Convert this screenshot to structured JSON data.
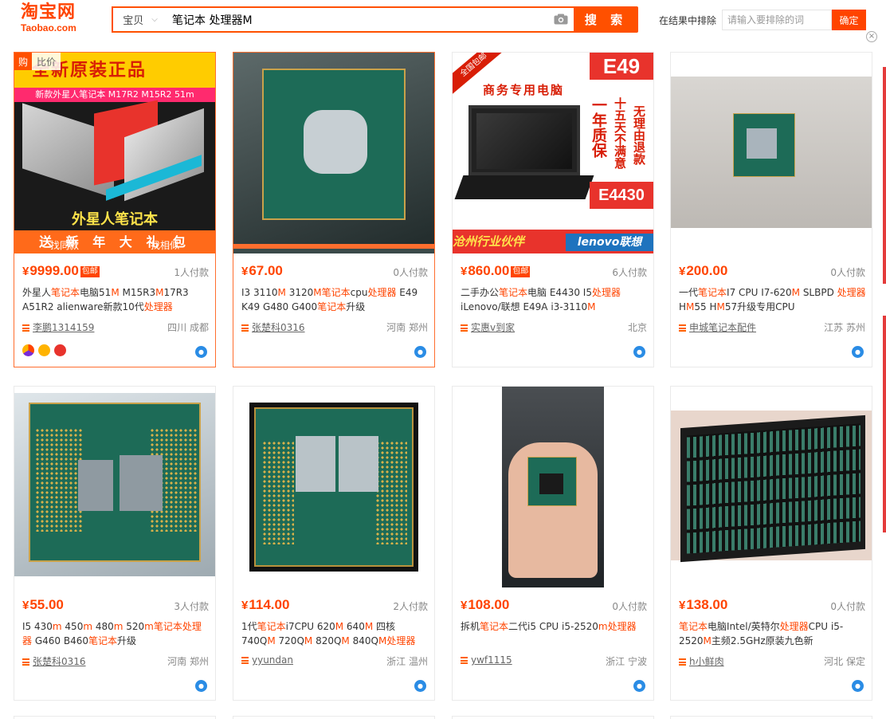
{
  "header": {
    "logo_cn": "淘宝网",
    "logo_en": "Taobao.com",
    "search_category": "宝贝",
    "search_query": "笔记本 处理器M",
    "search_button": "搜 索",
    "exclude_label": "在结果中排除",
    "exclude_placeholder": "请输入要排除的词",
    "confirm_button": "确定",
    "close_symbol": "×"
  },
  "colors": {
    "accent": "#ff4400",
    "search_border": "#ff5000",
    "link": "#666666",
    "wangwang": "#2a8ce5"
  },
  "card_overlay": {
    "buy_tag": "购",
    "compare_tag": "比价",
    "find_same": "找同款",
    "find_similar": "找相似"
  },
  "product_images": {
    "p1": {
      "headline": "全新原装正品",
      "subhead": "新款外星人笔记本 M17R2 M15R2 51m",
      "caption": "外星人笔记本",
      "footer": "送 新 年 大 礼 包"
    },
    "p3": {
      "corner": "全国包邮",
      "model_top": "E49",
      "headline": "商务专用电脑",
      "tagline1": "一年质保",
      "tagline2": "十五天不满意",
      "tagline3": "无理由退款",
      "model_bottom": "E4430",
      "footer": "沧州行业伙伴",
      "brand": "lenovo联想"
    }
  },
  "products": [
    {
      "price": "9999.00",
      "baoyou": "包邮",
      "paid": "1人付款",
      "title": [
        [
          "外星人",
          false
        ],
        [
          "笔记本",
          true
        ],
        [
          "电脑51",
          false
        ],
        [
          "M",
          true
        ],
        [
          " M15R3",
          false
        ],
        [
          "M",
          true
        ],
        [
          "17R3 A51R2 alienware新款10代",
          false
        ],
        [
          "处理器",
          true
        ]
      ],
      "shop": "李鹏1314159",
      "location": "四川 成都"
    },
    {
      "price": "67.00",
      "baoyou": "",
      "paid": "0人付款",
      "title": [
        [
          "I3 3110",
          false
        ],
        [
          "M",
          true
        ],
        [
          " 3120",
          false
        ],
        [
          "M",
          true
        ],
        [
          "笔记本",
          true
        ],
        [
          "cpu",
          false
        ],
        [
          "处理器",
          true
        ],
        [
          " E49 K49 G480 G400",
          false
        ],
        [
          "笔记本",
          true
        ],
        [
          "升级",
          false
        ]
      ],
      "shop": "张楚科0316",
      "location": "河南 郑州"
    },
    {
      "price": "860.00",
      "baoyou": "包邮",
      "paid": "6人付款",
      "title": [
        [
          "二手办公",
          false
        ],
        [
          "笔记本",
          true
        ],
        [
          "电脑 E4430 I5",
          false
        ],
        [
          "处理器",
          true
        ],
        [
          " iLenovo/联想 E49A i3-3110",
          false
        ],
        [
          "M",
          true
        ]
      ],
      "shop": "实惠v到家",
      "location": "北京"
    },
    {
      "price": "200.00",
      "baoyou": "",
      "paid": "0人付款",
      "title": [
        [
          "一代",
          false
        ],
        [
          "笔记本",
          true
        ],
        [
          "I7 CPU I7-620",
          false
        ],
        [
          "M",
          true
        ],
        [
          " SLBPD ",
          false
        ],
        [
          "处理器",
          true
        ],
        [
          " H",
          false
        ],
        [
          "M",
          true
        ],
        [
          "55 H",
          false
        ],
        [
          "M",
          true
        ],
        [
          "57升级专用CPU",
          false
        ]
      ],
      "shop": "申城笔记本配件",
      "location": "江苏 苏州"
    },
    {
      "price": "55.00",
      "baoyou": "",
      "paid": "3人付款",
      "title": [
        [
          "I5 430",
          false
        ],
        [
          "m",
          true
        ],
        [
          " 450",
          false
        ],
        [
          "m",
          true
        ],
        [
          " 480",
          false
        ],
        [
          "m",
          true
        ],
        [
          " 520",
          false
        ],
        [
          "m",
          true
        ],
        [
          "笔记本",
          true
        ],
        [
          "处理器",
          true
        ],
        [
          " G460 B460",
          false
        ],
        [
          "笔记本",
          true
        ],
        [
          "升级",
          false
        ]
      ],
      "shop": "张楚科0316",
      "location": "河南 郑州"
    },
    {
      "price": "114.00",
      "baoyou": "",
      "paid": "2人付款",
      "title": [
        [
          "1代",
          false
        ],
        [
          "笔记本",
          true
        ],
        [
          "i7CPU 620",
          false
        ],
        [
          "M",
          true
        ],
        [
          " 640",
          false
        ],
        [
          "M",
          true
        ],
        [
          " 四核 740Q",
          false
        ],
        [
          "M",
          true
        ],
        [
          " 720Q",
          false
        ],
        [
          "M",
          true
        ],
        [
          " 820Q",
          false
        ],
        [
          "M",
          true
        ],
        [
          " 840Q",
          false
        ],
        [
          "M",
          true
        ],
        [
          "处理器",
          true
        ]
      ],
      "shop": "yyundan",
      "location": "浙江 温州"
    },
    {
      "price": "108.00",
      "baoyou": "",
      "paid": "0人付款",
      "title": [
        [
          "拆机",
          false
        ],
        [
          "笔记本",
          true
        ],
        [
          "二代i5 CPU i5-2520",
          false
        ],
        [
          "m",
          true
        ],
        [
          "处理器",
          true
        ]
      ],
      "shop": "ywf1115",
      "location": "浙江 宁波"
    },
    {
      "price": "138.00",
      "baoyou": "",
      "paid": "0人付款",
      "title": [
        [
          "笔记本",
          true
        ],
        [
          "电脑Intel/英特尔",
          false
        ],
        [
          "处理器",
          true
        ],
        [
          "CPU i5-2520",
          false
        ],
        [
          "M",
          true
        ],
        [
          "主频2.5GHz原装九色新",
          false
        ]
      ],
      "shop": "h小鲜肉",
      "location": "河北 保定"
    }
  ],
  "currency_symbol": "¥"
}
